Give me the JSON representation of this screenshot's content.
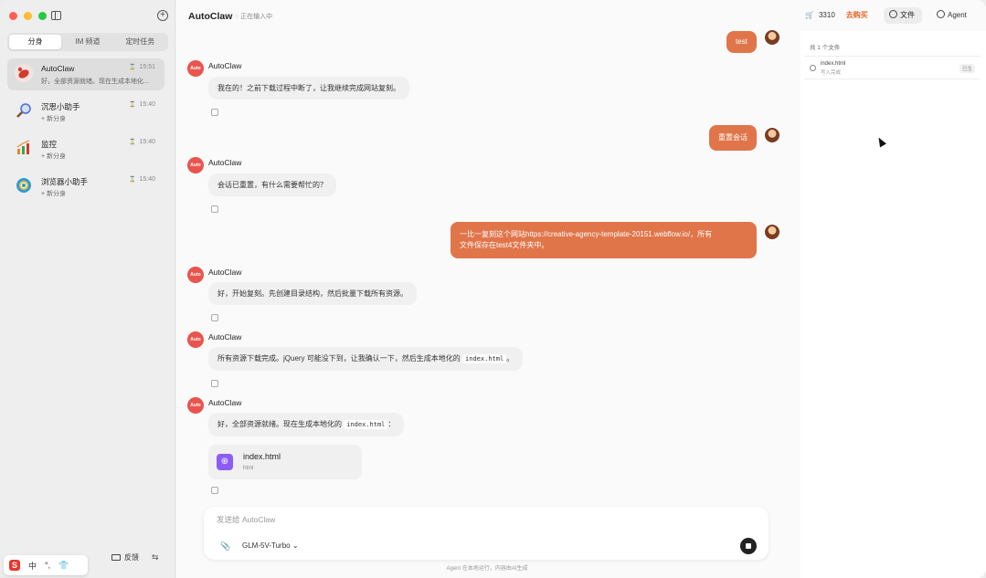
{
  "sidebar": {
    "tabs": [
      {
        "label": "分身",
        "active": true
      },
      {
        "label": "IM 频道",
        "active": false
      },
      {
        "label": "定时任务",
        "active": false
      }
    ],
    "sessions": [
      {
        "title": "AutoClaw",
        "time": "15:51",
        "subtitle": "好，全部资源就绪。现在生成本地化...",
        "icon": "lobster-icon",
        "color": "#d23b2f"
      },
      {
        "title": "沉思小助手",
        "time": "15:40",
        "subtitle": "+ 新分身",
        "icon": "magnifier-icon",
        "color": "#4a6fd1"
      },
      {
        "title": "监控",
        "time": "15:40",
        "subtitle": "+ 新分身",
        "icon": "chart-icon",
        "color": "#e08a2c"
      },
      {
        "title": "浏览器小助手",
        "time": "15:40",
        "subtitle": "+ 新分身",
        "icon": "browser-icon",
        "color": "#2f9bd6"
      }
    ],
    "ime": {
      "lang": "中",
      "punct": "°,"
    },
    "feedback_label": "反馈"
  },
  "header": {
    "title": "AutoClaw",
    "status": "正在输入中",
    "points": "3310",
    "buy_label": "去购买",
    "files_label": "文件",
    "agent_label": "Agent"
  },
  "messages": {
    "user1": "test",
    "bot_name": "AutoClaw",
    "bot_avatar_text": "Auto",
    "bot1": "我在的！之前下载过程中断了，让我继续完成网站复刻。",
    "user2": "重置会话",
    "bot2": "会话已重置，有什么需要帮忙的？",
    "user3_line1": "一比一复刻这个网站https://creative-agency-template-20151.webflow.io/，所有",
    "user3_line2": "文件保存在test4文件夹中。",
    "bot3": "好，开始复刻。先创建目录结构，然后批量下载所有资源。",
    "bot4_pre": "所有资源下载完成。jQuery 可能没下到，让我确认一下，然后生成本地化的",
    "bot4_code": "index.html",
    "bot4_post": "。",
    "bot5_pre": "好，全部资源就绪。现在生成本地化的",
    "bot5_code": "index.html",
    "bot5_post": "："
  },
  "file_card": {
    "name": "index.html",
    "type": "html"
  },
  "composer": {
    "placeholder": "发送给 AutoClaw",
    "model": "GLM-5V-Turbo",
    "footnote": "Agent 在本地运行，内容由AI生成"
  },
  "files_panel": {
    "count_label": "共 1 个文件",
    "files": [
      {
        "name": "index.html",
        "status": "写入完成",
        "badge": "已生"
      }
    ]
  },
  "colors": {
    "accent": "#e0754a",
    "buy": "#e46a2c",
    "bot_avatar": "#e8554e"
  }
}
